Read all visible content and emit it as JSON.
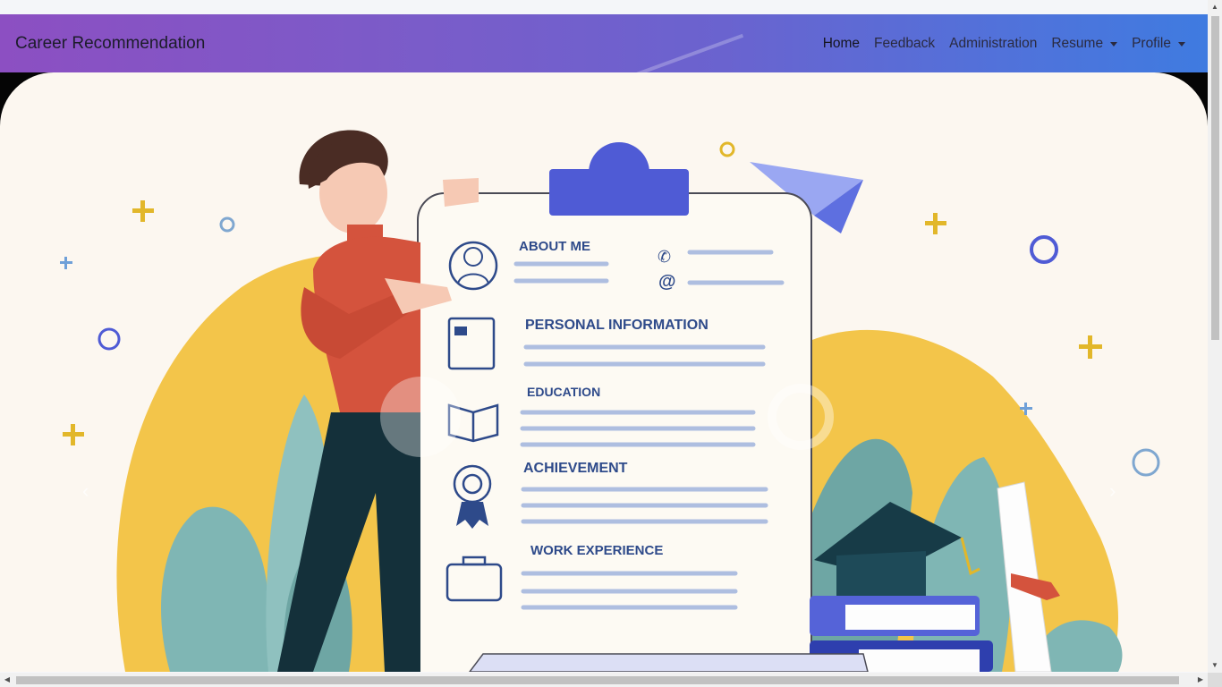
{
  "navbar": {
    "brand": "Career Recommendation",
    "links": [
      {
        "label": "Home",
        "active": true
      },
      {
        "label": "Feedback"
      },
      {
        "label": "Administration"
      },
      {
        "label": "Resume",
        "dropdown": true
      },
      {
        "label": "Profile",
        "dropdown": true
      }
    ]
  },
  "hero": {
    "resume_sections": [
      "ABOUT ME",
      "PERSONAL INFORMATION",
      "EDUCATION",
      "ACHIEVEMENT",
      "WORK EXPERIENCE"
    ],
    "carousel_prev_icon": "chevron-left-icon",
    "carousel_next_icon": "chevron-right-icon"
  },
  "colors": {
    "navbar_start": "#8c4fc2",
    "navbar_end": "#3f7be0",
    "hero_bg": "#fcf7f0",
    "accent_yellow": "#f3c54a",
    "accent_teal": "#7fb6b4",
    "accent_blue": "#4f5bd5"
  }
}
